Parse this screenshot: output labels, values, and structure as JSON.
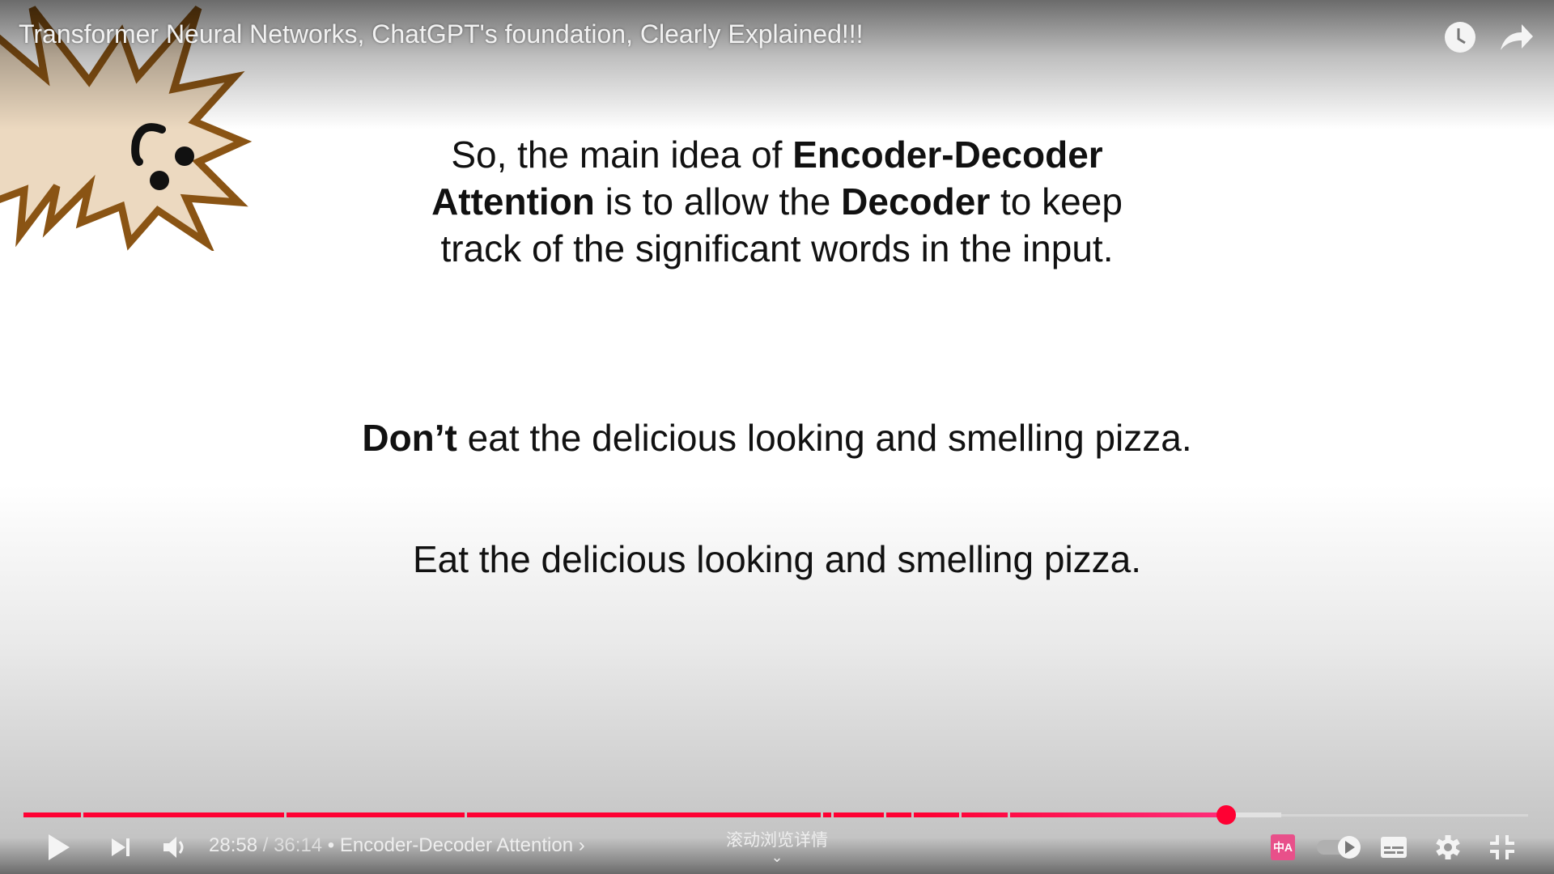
{
  "video": {
    "title": "Transformer Neural Networks, ChatGPT's foundation, Clearly Explained!!!",
    "top_icons": [
      "clock-icon",
      "share-icon"
    ]
  },
  "slide": {
    "line1": {
      "pre": "So, the main idea of ",
      "bold": "Encoder-Decoder"
    },
    "line2": {
      "bold1": "Attention",
      "mid": " is to allow the ",
      "bold2": "Decoder",
      "post": " to keep"
    },
    "line3": "track of the significant words in the input.",
    "sentence1": {
      "bold": "Don’t",
      "rest": " eat the delicious looking and smelling pizza."
    },
    "sentence2": "Eat the delicious looking and smelling pizza."
  },
  "player": {
    "current_time": "28:58",
    "separator": " / ",
    "duration": "36:14",
    "chapter_dot": " • ",
    "chapter": "Encoder-Decoder Attention",
    "chapter_chevron": "›",
    "scroll_hint": "滚动浏览详情",
    "progress_fraction": 0.7995,
    "buffered_fraction": 0.836,
    "progress_color": "#ff0033",
    "translate_badge": "中A",
    "translate_color": "#e8508a",
    "icons": [
      "play-icon",
      "next-icon",
      "volume-icon",
      "translate-icon",
      "autoplay-toggle",
      "subtitles-icon",
      "settings-icon",
      "exit-fullscreen-icon"
    ]
  }
}
